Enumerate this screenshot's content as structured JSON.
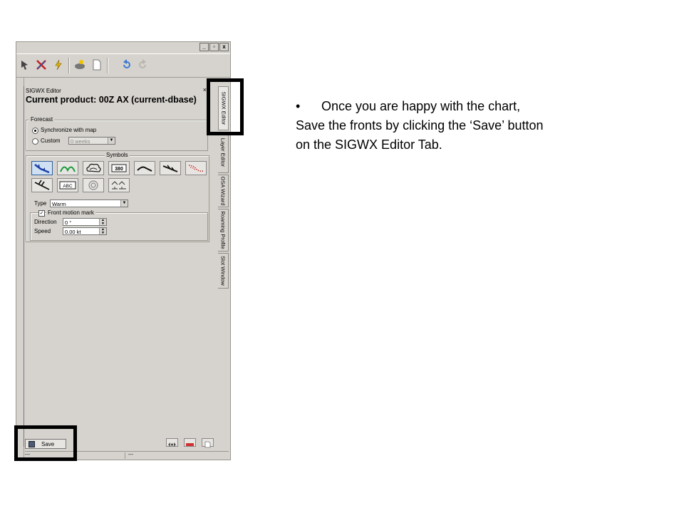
{
  "window": {
    "minimize": "_",
    "restore": "▫",
    "close": "x"
  },
  "panel": {
    "title": "SIGWX Editor",
    "close": "×",
    "current_product": "Current product: 00Z AX (current-dbase)"
  },
  "forecast": {
    "group_label": "Forecast",
    "sync_label": "Synchronize with map",
    "custom_label": "Custom",
    "custom_value": "0 weeks"
  },
  "symbols": {
    "group_label": "Symbols",
    "items": [
      {
        "name": "cold-front-symbol",
        "selected": true
      },
      {
        "name": "warm-front-symbol",
        "selected": false
      },
      {
        "name": "cb-cloud-symbol",
        "selected": false
      },
      {
        "name": "flight-level-box-symbol",
        "label": "380",
        "selected": false
      },
      {
        "name": "jet-stream-symbol",
        "selected": false
      },
      {
        "name": "turbulence-line-symbol",
        "selected": false
      },
      {
        "name": "turbulence-area-symbol",
        "selected": false
      },
      {
        "name": "wind-barb-symbol",
        "selected": false
      },
      {
        "name": "text-box-symbol",
        "label": "ABC",
        "selected": false
      },
      {
        "name": "tropical-cyclone-symbol",
        "selected": false
      },
      {
        "name": "volcano-symbol",
        "selected": false
      }
    ]
  },
  "front": {
    "type_label": "Type",
    "type_value": "Warm",
    "motion_label": "Front motion mark",
    "motion_checked": true,
    "direction_label": "Direction",
    "direction_value": "0 °",
    "speed_label": "Speed",
    "speed_value": "0.00 kt"
  },
  "save_label": "Save",
  "status": {
    "left": "---",
    "mid": "---"
  },
  "tabs": [
    "SIGWX Editor",
    "Layer Editor",
    "OSA Wizard",
    "Roaming Profile",
    "Slot Window"
  ],
  "instructions": {
    "bullet": "•",
    "line1": "Once you are happy with the chart,",
    "line2": "Save the fronts by clicking the ‘Save’ button",
    "line3": "on the SIGWX Editor Tab."
  }
}
